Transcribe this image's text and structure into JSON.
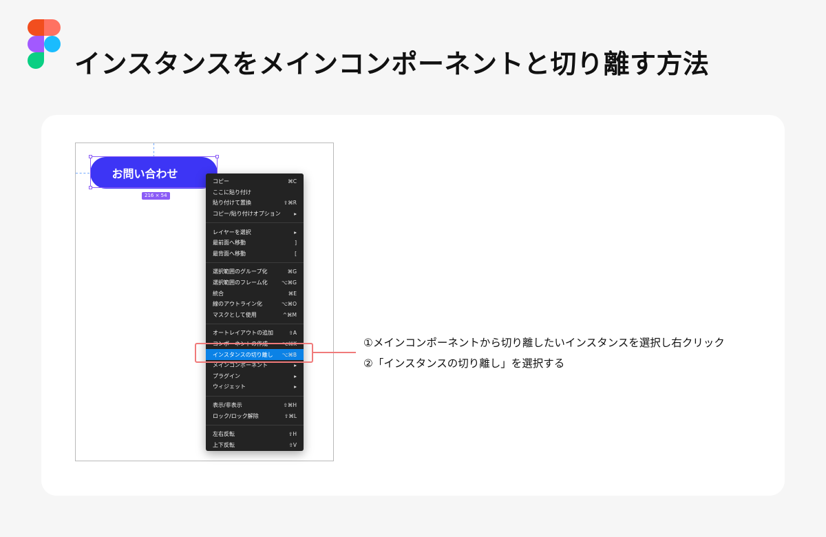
{
  "page": {
    "title": "インスタンスをメインコンポーネントと切り離す方法"
  },
  "logo": {
    "icon": "figma-logo-icon",
    "colors": [
      "#f24e1e",
      "#ff7262",
      "#a259ff",
      "#1abcfe",
      "#0acf83"
    ]
  },
  "canvas": {
    "button_label": "お問い合わせ",
    "button_color": "#3d35f5",
    "size_badge": "216 × 54"
  },
  "context_menu": {
    "groups": [
      [
        {
          "label": "コピー",
          "shortcut": "⌘C"
        },
        {
          "label": "ここに貼り付け",
          "shortcut": ""
        },
        {
          "label": "貼り付けて置換",
          "shortcut": "⇧⌘R"
        },
        {
          "label": "コピー/貼り付けオプション",
          "shortcut": "▸"
        }
      ],
      [
        {
          "label": "レイヤーを選択",
          "shortcut": "▸"
        },
        {
          "label": "最前面へ移動",
          "shortcut": "]"
        },
        {
          "label": "最背面へ移動",
          "shortcut": "["
        }
      ],
      [
        {
          "label": "選択範囲のグループ化",
          "shortcut": "⌘G"
        },
        {
          "label": "選択範囲のフレーム化",
          "shortcut": "⌥⌘G"
        },
        {
          "label": "統合",
          "shortcut": "⌘E"
        },
        {
          "label": "線のアウトライン化",
          "shortcut": "⌥⌘O"
        },
        {
          "label": "マスクとして使用",
          "shortcut": "^⌘M"
        }
      ],
      [
        {
          "label": "オートレイアウトの追加",
          "shortcut": "⇧A"
        },
        {
          "label": "コンポーネントの作成",
          "shortcut": "⌥⌘K"
        },
        {
          "label": "インスタンスの切り離し",
          "shortcut": "⌥⌘B",
          "highlighted": true
        },
        {
          "label": "メインコンポーネント",
          "shortcut": "▸"
        },
        {
          "label": "プラグイン",
          "shortcut": "▸"
        },
        {
          "label": "ウィジェット",
          "shortcut": "▸"
        }
      ],
      [
        {
          "label": "表示/非表示",
          "shortcut": "⇧⌘H"
        },
        {
          "label": "ロック/ロック解除",
          "shortcut": "⇧⌘L"
        }
      ],
      [
        {
          "label": "左右反転",
          "shortcut": "⇧H"
        },
        {
          "label": "上下反転",
          "shortcut": "⇧V"
        }
      ]
    ],
    "highlight_color": "#0b82e6"
  },
  "callout": {
    "color": "#f07a7a"
  },
  "steps": [
    "①メインコンポーネントから切り離したいインスタンスを選択し右クリック",
    "②「インスタンスの切り離し」を選択する"
  ]
}
